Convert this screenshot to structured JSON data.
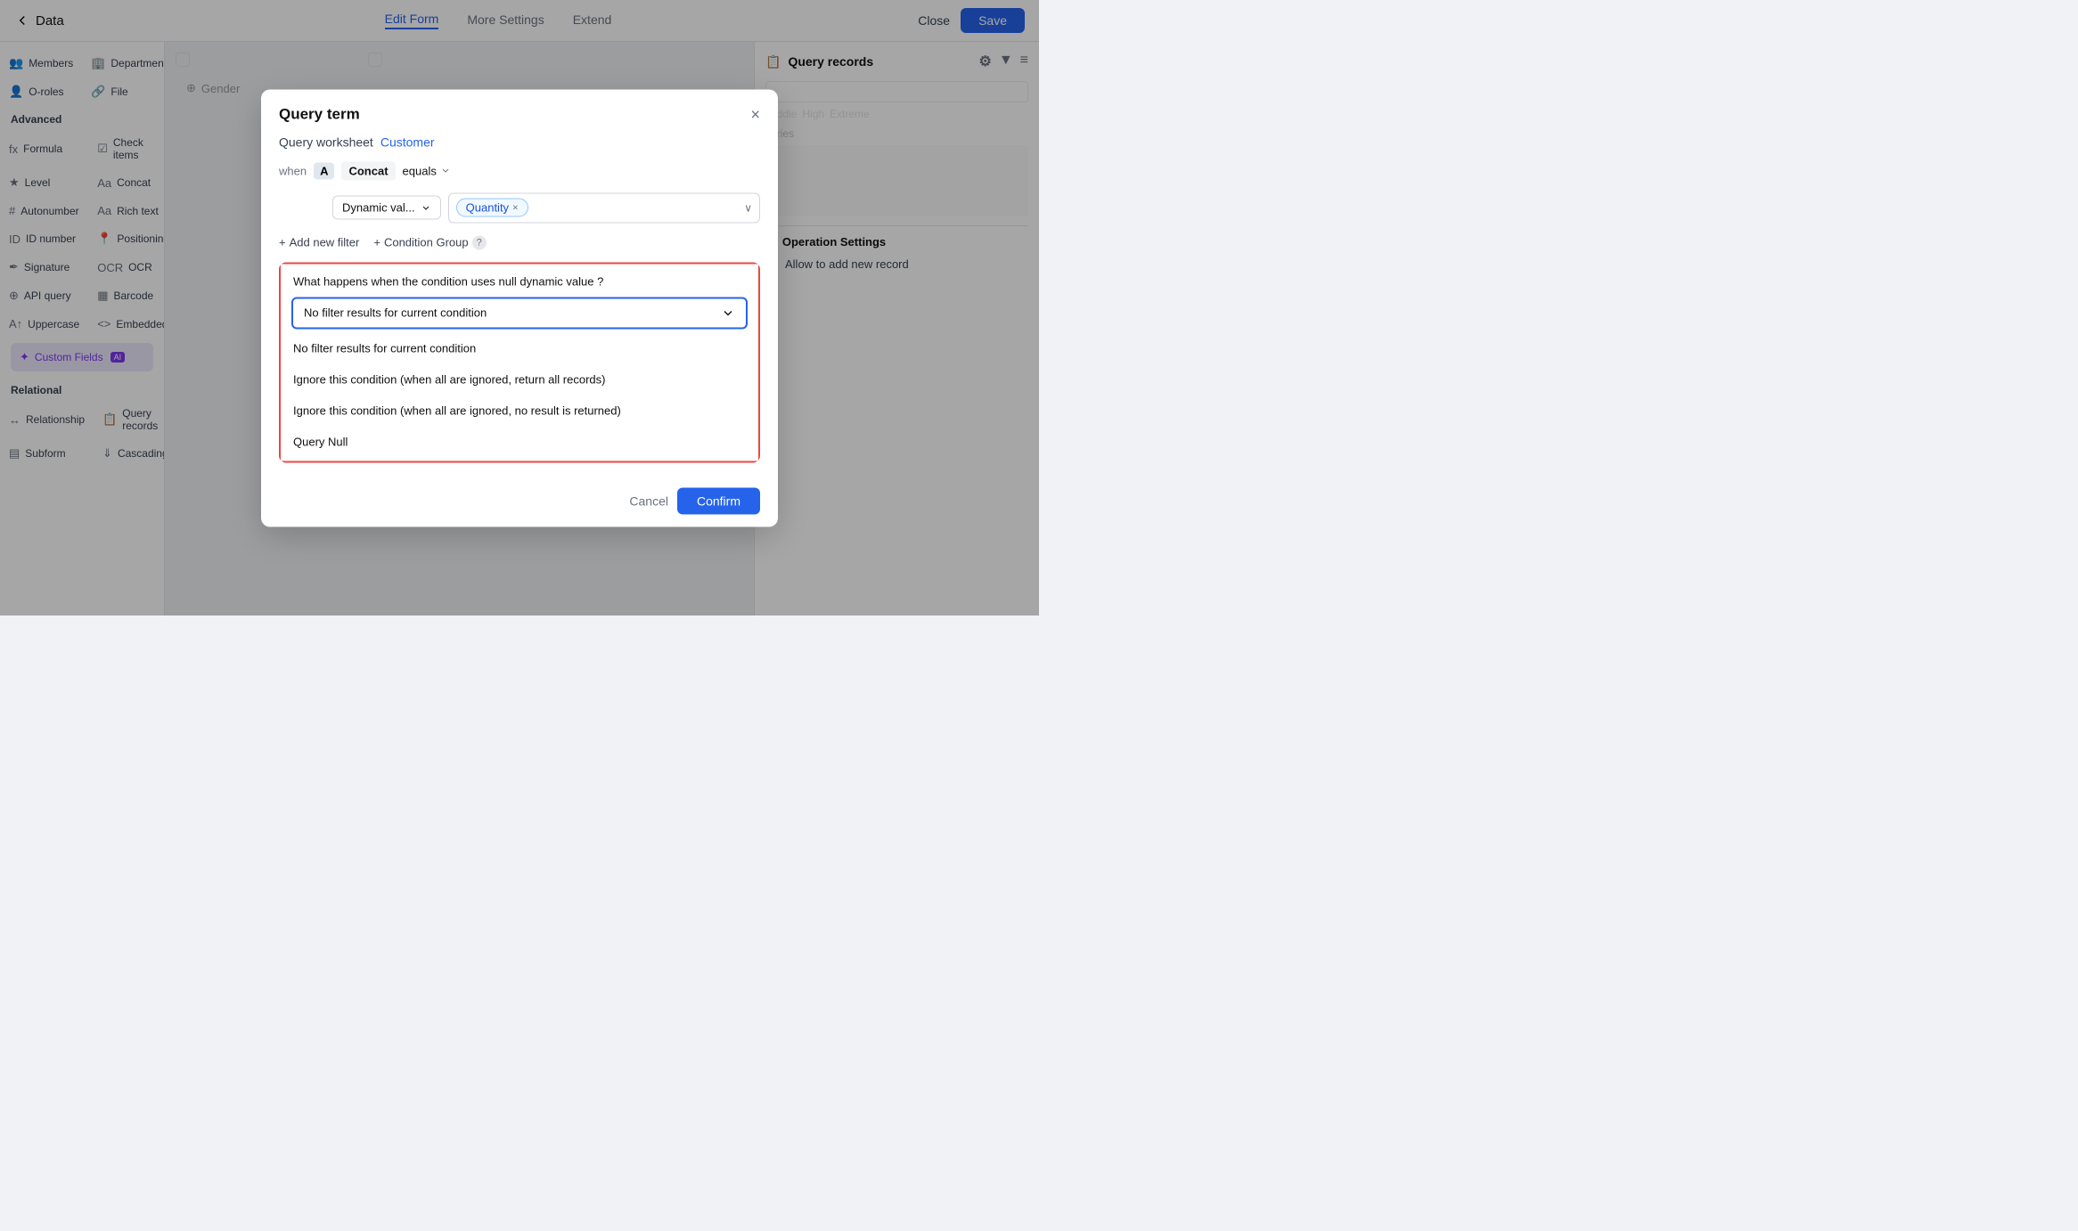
{
  "topbar": {
    "back_label": "Data",
    "tabs": [
      {
        "label": "Edit Form",
        "active": true
      },
      {
        "label": "More Settings",
        "active": false
      },
      {
        "label": "Extend",
        "active": false
      }
    ],
    "close_label": "Close",
    "save_label": "Save"
  },
  "sidebar": {
    "advanced_title": "Advanced",
    "items_advanced": [
      {
        "icon": "fx",
        "label": "Formula"
      },
      {
        "icon": "✓",
        "label": "Check items"
      },
      {
        "icon": "★",
        "label": "Level"
      },
      {
        "icon": "Aa",
        "label": "Concat"
      },
      {
        "icon": "#",
        "label": "Autonumber"
      },
      {
        "icon": "Aa",
        "label": "Rich text"
      },
      {
        "icon": "ID",
        "label": "ID number"
      },
      {
        "icon": "📍",
        "label": "Positioning"
      },
      {
        "icon": "✒",
        "label": "Signature"
      },
      {
        "icon": "OCR",
        "label": "OCR"
      },
      {
        "icon": "⊕",
        "label": "API query"
      },
      {
        "icon": "▦",
        "label": "Barcode"
      },
      {
        "icon": "A",
        "label": "Uppercase"
      },
      {
        "icon": "<>",
        "label": "Embedded"
      }
    ],
    "custom_fields_label": "Custom Fields",
    "custom_fields_ai": "AI",
    "relational_title": "Relational",
    "items_relational": [
      {
        "icon": "↔",
        "label": "Relationship"
      },
      {
        "icon": "📋",
        "label": "Query records"
      },
      {
        "icon": "▤",
        "label": "Subform"
      },
      {
        "icon": "⇓",
        "label": "Cascading"
      }
    ]
  },
  "right_panel": {
    "title": "Query records",
    "operation_settings_title": "Operation Settings",
    "allow_add_label": "Allow to add new record",
    "severity_labels": [
      "Middle",
      "High",
      "Extreme"
    ]
  },
  "modal": {
    "title": "Query term",
    "close_icon": "×",
    "query_worksheet_label": "Query worksheet",
    "query_worksheet_link": "Customer",
    "filter": {
      "when_label": "when",
      "field_letter": "A",
      "field_name": "Concat",
      "operator": "equals",
      "dynamic_val_label": "Dynamic val...",
      "value_tag": "Quantity"
    },
    "add_filter_label": "Add new filter",
    "condition_group_label": "Condition Group",
    "null_section": {
      "question": "What happens when the condition uses null dynamic value ?",
      "selected_option": "No filter results for current condition",
      "options": [
        "No filter results for current condition",
        "Ignore this condition (when all are ignored, return all records)",
        "Ignore this condition (when all are ignored, no result is returned)",
        "Query Null"
      ]
    },
    "cancel_label": "Cancel",
    "confirm_label": "Confirm"
  }
}
